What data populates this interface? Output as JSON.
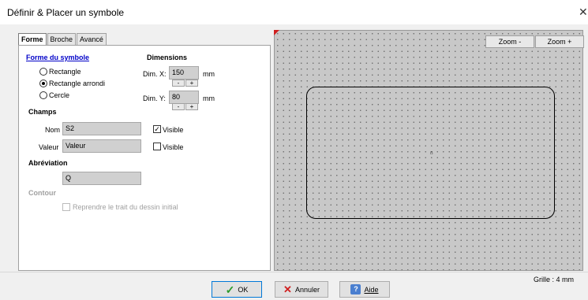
{
  "window": {
    "title": "Définir & Placer un symbole"
  },
  "tabs": [
    {
      "label": "Forme",
      "active": true
    },
    {
      "label": "Broche",
      "active": false
    },
    {
      "label": "Avancé",
      "active": false
    }
  ],
  "shape": {
    "heading": "Forme du symbole",
    "options": [
      {
        "label": "Rectangle",
        "selected": false
      },
      {
        "label": "Rectangle arrondi",
        "selected": true
      },
      {
        "label": "Cercle",
        "selected": false
      }
    ]
  },
  "dimensions": {
    "heading": "Dimensions",
    "x_label": "Dim. X:",
    "x_value": "150",
    "y_label": "Dim. Y:",
    "y_value": "80",
    "unit": "mm",
    "minus": "-",
    "plus": "+"
  },
  "fields": {
    "heading": "Champs",
    "nom_label": "Nom",
    "nom_value": "S2",
    "nom_visible_label": "Visible",
    "nom_visible": true,
    "valeur_label": "Valeur",
    "valeur_value": "Valeur",
    "valeur_visible_label": "Visible",
    "valeur_visible": false
  },
  "abbreviation": {
    "heading": "Abréviation",
    "value": "Q"
  },
  "contour": {
    "heading": "Contour",
    "checkbox_label": "Reprendre le trait du dessin initial",
    "checked": false
  },
  "canvas": {
    "zoom_out": "Zoom -",
    "zoom_in": "Zoom +",
    "grid_label": "Grille : 4 mm",
    "center_mark": "ẞ"
  },
  "buttons": {
    "ok": "OK",
    "cancel": "Annuler",
    "help": "Aide"
  },
  "colors": {
    "accent": "#0078d7",
    "link": "#0000c8",
    "ok_icon": "#2a9a2a",
    "cancel_icon": "#d02020"
  }
}
